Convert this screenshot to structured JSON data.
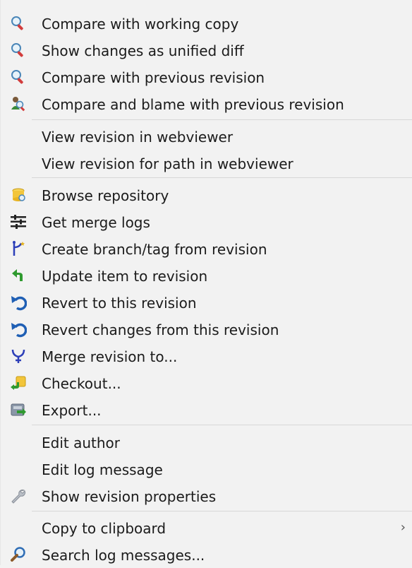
{
  "menu": {
    "items": [
      {
        "label": "Compare with working copy",
        "icon": "compare-magnifier-icon"
      },
      {
        "label": "Show changes as unified diff",
        "icon": "diff-magnifier-icon"
      },
      {
        "label": "Compare with previous revision",
        "icon": "compare-previous-magnifier-icon"
      },
      {
        "label": "Compare and blame with previous revision",
        "icon": "blame-icon"
      },
      {
        "label": "View revision in webviewer"
      },
      {
        "label": "View revision for path in webviewer"
      },
      {
        "label": "Browse repository",
        "icon": "repository-browser-icon"
      },
      {
        "label": "Get merge logs",
        "icon": "merge-logs-icon"
      },
      {
        "label": "Create branch/tag from revision",
        "icon": "branch-tag-icon"
      },
      {
        "label": "Update item to revision",
        "icon": "update-arrow-icon"
      },
      {
        "label": "Revert to this revision",
        "icon": "revert-arrow-icon"
      },
      {
        "label": "Revert changes from this revision",
        "icon": "revert-changes-arrow-icon"
      },
      {
        "label": "Merge revision to...",
        "icon": "merge-icon"
      },
      {
        "label": "Checkout...",
        "icon": "checkout-icon"
      },
      {
        "label": "Export...",
        "icon": "export-icon"
      },
      {
        "label": "Edit author"
      },
      {
        "label": "Edit log message"
      },
      {
        "label": "Show revision properties",
        "icon": "wrench-icon"
      },
      {
        "label": "Copy to clipboard",
        "submenu_arrow": "›"
      },
      {
        "label": "Search log messages...",
        "icon": "search-icon"
      }
    ]
  }
}
